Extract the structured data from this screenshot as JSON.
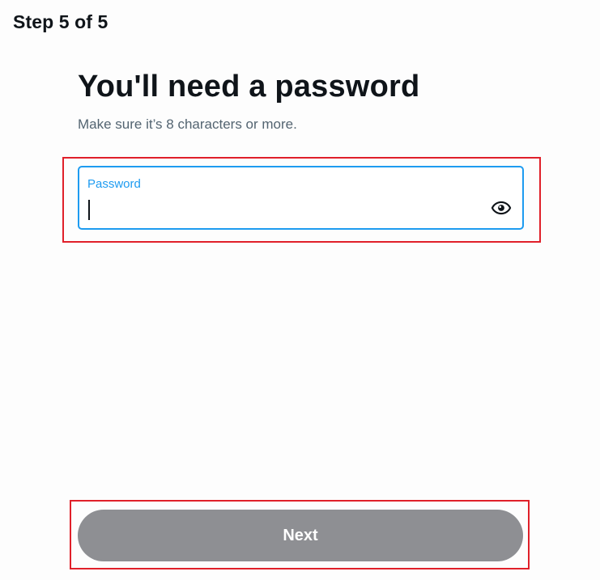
{
  "header": {
    "step_label": "Step 5 of 5"
  },
  "main": {
    "title": "You'll need a password",
    "subtitle": "Make sure it’s 8 characters or more.",
    "password_field": {
      "label": "Password",
      "value": "",
      "toggle_icon": "eye-icon"
    },
    "next_button_label": "Next"
  },
  "colors": {
    "accent": "#1d9bf0",
    "highlight": "#e0202a",
    "button_disabled": "#8e8f93",
    "text_primary": "#0f1419",
    "text_secondary": "#536471"
  }
}
